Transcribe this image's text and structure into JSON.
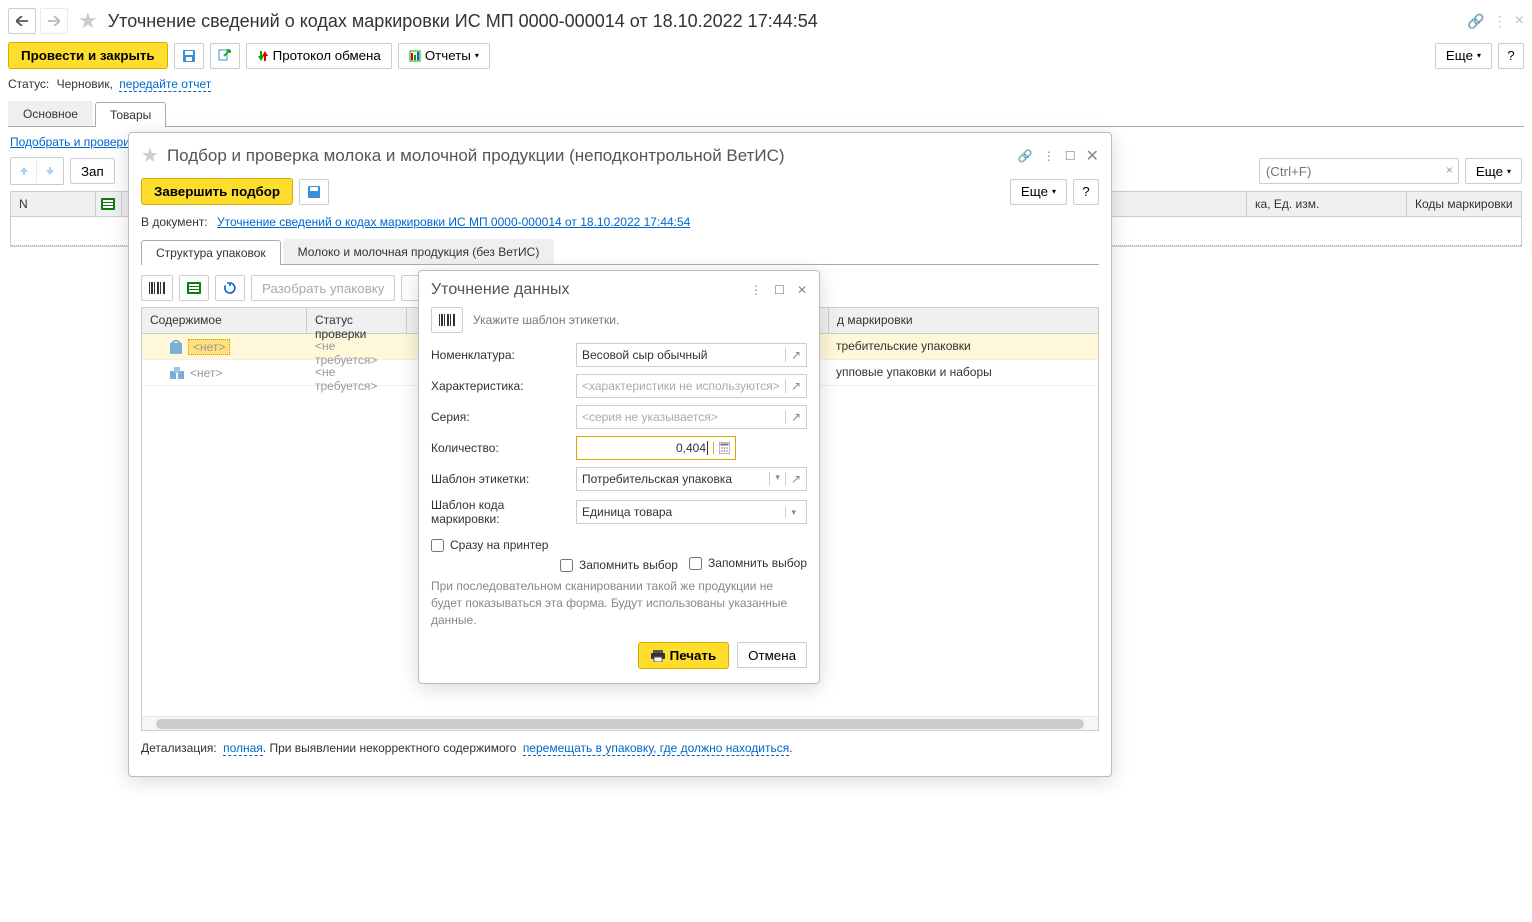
{
  "main": {
    "title": "Уточнение сведений о кодах маркировки ИС МП 0000-000014 от 18.10.2022 17:44:54",
    "toolbar": {
      "post_close": "Провести и закрыть",
      "protocol": "Протокол обмена",
      "reports": "Отчеты",
      "more": "Еще"
    },
    "status_label": "Статус:",
    "status_value": "Черновик,",
    "status_link": "передайте отчет",
    "tabs": {
      "main": "Основное",
      "goods": "Товары"
    },
    "pick_check_link": "Подобрать и проверить",
    "search_placeholder": "(Ctrl+F)",
    "more_btn": "Еще",
    "fill_btn": "Зап",
    "columns": {
      "n": "N",
      "pack_unit": "ка, Ед. изм.",
      "mark_codes": "Коды маркировки"
    }
  },
  "pick_window": {
    "title": "Подбор и проверка молока и молочной продукции (неподконтрольной ВетИС)",
    "complete": "Завершить подбор",
    "more": "Еще",
    "to_doc_label": "В документ:",
    "to_doc_link": "Уточнение сведений о кодах маркировки ИС МП 0000-000014 от 18.10.2022 17:44:54",
    "tabs": {
      "struct": "Структура упаковок",
      "milk": "Молоко и молочная продукция (без ВетИС)"
    },
    "unpack_btn": "Разобрать упаковку",
    "columns": {
      "content": "Содержимое",
      "status": "Статус проверки",
      "mark_type": "д маркировки"
    },
    "rows": [
      {
        "content": "<нет>",
        "status": "<не требуется>",
        "mark": "требительские упаковки"
      },
      {
        "content": "<нет>",
        "status": "<не требуется>",
        "mark": "упповые упаковки и наборы"
      }
    ],
    "detail_label": "Детализация:",
    "detail_link": "полная",
    "detail_text": ". При выявлении некорректного содержимого",
    "detail_text_link": "перемещать в упаковку, где должно находиться",
    "detail_text_end": "."
  },
  "dialog": {
    "title": "Уточнение данных",
    "hint": "Укажите шаблон этикетки.",
    "fields": {
      "nomenclature_label": "Номенклатура:",
      "nomenclature_value": "Весовой сыр обычный",
      "characteristic_label": "Характеристика:",
      "characteristic_placeholder": "<характеристики не используются>",
      "series_label": "Серия:",
      "series_placeholder": "<серия не указывается>",
      "quantity_label": "Количество:",
      "quantity_value": "0,404",
      "label_template_label": "Шаблон этикетки:",
      "label_template_value": "Потребительская упаковка",
      "mark_template_label": "Шаблон кода маркировки:",
      "mark_template_value": "Единица товара"
    },
    "to_printer": "Сразу на принтер",
    "remember": "Запомнить выбор",
    "note": "При последовательном сканировании такой же продукции не будет показываться эта форма. Будут использованы указанные данные.",
    "print": "Печать",
    "cancel": "Отмена"
  }
}
